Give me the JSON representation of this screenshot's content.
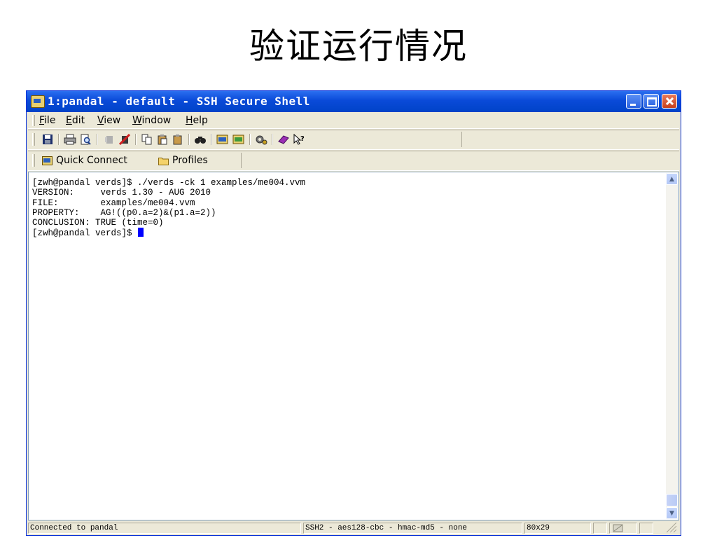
{
  "slide": {
    "title": "验证运行情况"
  },
  "window": {
    "title": "1:pandal - default - SSH Secure Shell",
    "controls": {
      "minimize": "minimize-icon",
      "maximize": "maximize-icon",
      "close": "close-icon"
    }
  },
  "menu": {
    "items": [
      {
        "underline": "F",
        "rest": "ile"
      },
      {
        "underline": "E",
        "rest": "dit"
      },
      {
        "underline": "V",
        "rest": "iew"
      },
      {
        "underline": "W",
        "rest": "indow"
      },
      {
        "underline": "H",
        "rest": "elp"
      }
    ]
  },
  "toolbar": {
    "icons": [
      "save-icon",
      "print-icon",
      "print-preview-icon",
      "disabled-icon",
      "disconnect-icon",
      "copy-icon",
      "paste-icon",
      "paste-special-icon",
      "find-icon",
      "new-terminal-icon",
      "new-file-transfer-icon",
      "settings-icon",
      "help-book-icon",
      "context-help-icon"
    ]
  },
  "quickbar": {
    "quick_connect": "Quick Connect",
    "profiles": "Profiles"
  },
  "terminal": {
    "lines": [
      "[zwh@pandal verds]$ ./verds -ck 1 examples/me004.vvm",
      "VERSION:     verds 1.30 - AUG 2010",
      "FILE:        examples/me004.vvm",
      "PROPERTY:    AG!((p0.a=2)&(p1.a=2))",
      "CONCLUSION: TRUE (time=0)"
    ],
    "prompt": "[zwh@pandal verds]$ "
  },
  "statusbar": {
    "connection": "Connected to pandal",
    "cipher": "SSH2 - aes128-cbc - hmac-md5 - none",
    "size": "80x29"
  },
  "colors": {
    "titlebar": "#0a4ad8",
    "chrome": "#ece9d8",
    "cursor": "#0000ff"
  }
}
